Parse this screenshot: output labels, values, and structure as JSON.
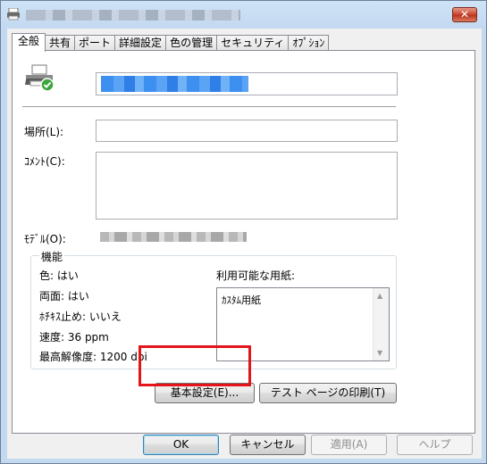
{
  "window": {
    "close_glyph": "✕"
  },
  "tabs": [
    {
      "label": "全般",
      "active": true
    },
    {
      "label": "共有"
    },
    {
      "label": "ポート"
    },
    {
      "label": "詳細設定"
    },
    {
      "label": "色の管理"
    },
    {
      "label": "セキュリティ"
    },
    {
      "label": "ｵﾌﾟｼｮﾝ"
    }
  ],
  "general": {
    "location_label": "場所(L):",
    "location_value": "",
    "comment_label": "ｺﾒﾝﾄ(C):",
    "comment_value": "",
    "model_label": "ﾓﾃﾞﾙ(O):"
  },
  "features": {
    "title": "機能",
    "color": "色: はい",
    "duplex": "両面: はい",
    "staple": "ﾎﾁｷｽ止め: いいえ",
    "speed": "速度: 36 ppm",
    "resolution": "最高解像度: 1200 dpi",
    "paper_label": "利用可能な用紙:",
    "paper_items": [
      "ｶｽﾀﾑ用紙"
    ]
  },
  "buttons": {
    "preferences": "基本設定(E)...",
    "test_page": "テスト ページの印刷(T)",
    "ok": "OK",
    "cancel": "キャンセル",
    "apply": "適用(A)",
    "help": "ヘルプ"
  },
  "colors": {
    "highlight": "#e3151a",
    "name_selection": "#3d8ff0"
  }
}
